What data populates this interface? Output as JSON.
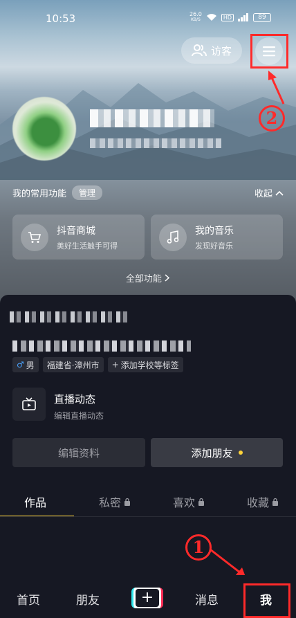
{
  "status_bar": {
    "time": "10:53",
    "net_speed": "26.0",
    "net_unit": "KB/S",
    "hd": "HD",
    "battery": "89"
  },
  "header": {
    "visitor_label": "访客"
  },
  "annotations": {
    "step1": "1",
    "step2": "2",
    "color": "#ff2a2a"
  },
  "functions": {
    "title": "我的常用功能",
    "manage_label": "管理",
    "collapse_label": "收起",
    "cards": [
      {
        "title": "抖音商城",
        "subtitle": "美好生活触手可得",
        "icon": "shopping-cart-icon"
      },
      {
        "title": "我的音乐",
        "subtitle": "发现好音乐",
        "icon": "music-note-icon"
      }
    ],
    "all_label": "全部功能"
  },
  "profile": {
    "gender": "男",
    "location": "福建省·漳州市",
    "add_tag_label": "添加学校等标签",
    "live": {
      "title": "直播动态",
      "subtitle": "编辑直播动态",
      "icon": "tv-icon"
    },
    "edit_label": "编辑资料",
    "add_friend_label": "添加朋友"
  },
  "tabs": [
    {
      "label": "作品",
      "locked": false
    },
    {
      "label": "私密",
      "locked": true
    },
    {
      "label": "喜欢",
      "locked": true
    },
    {
      "label": "收藏",
      "locked": true
    }
  ],
  "nav": {
    "home": "首页",
    "friends": "朋友",
    "messages": "消息",
    "me": "我"
  },
  "colors": {
    "accent": "#ffd33a",
    "background": "#161823",
    "tiktok_cyan": "#2ee6ed",
    "tiktok_red": "#fe2c55"
  }
}
